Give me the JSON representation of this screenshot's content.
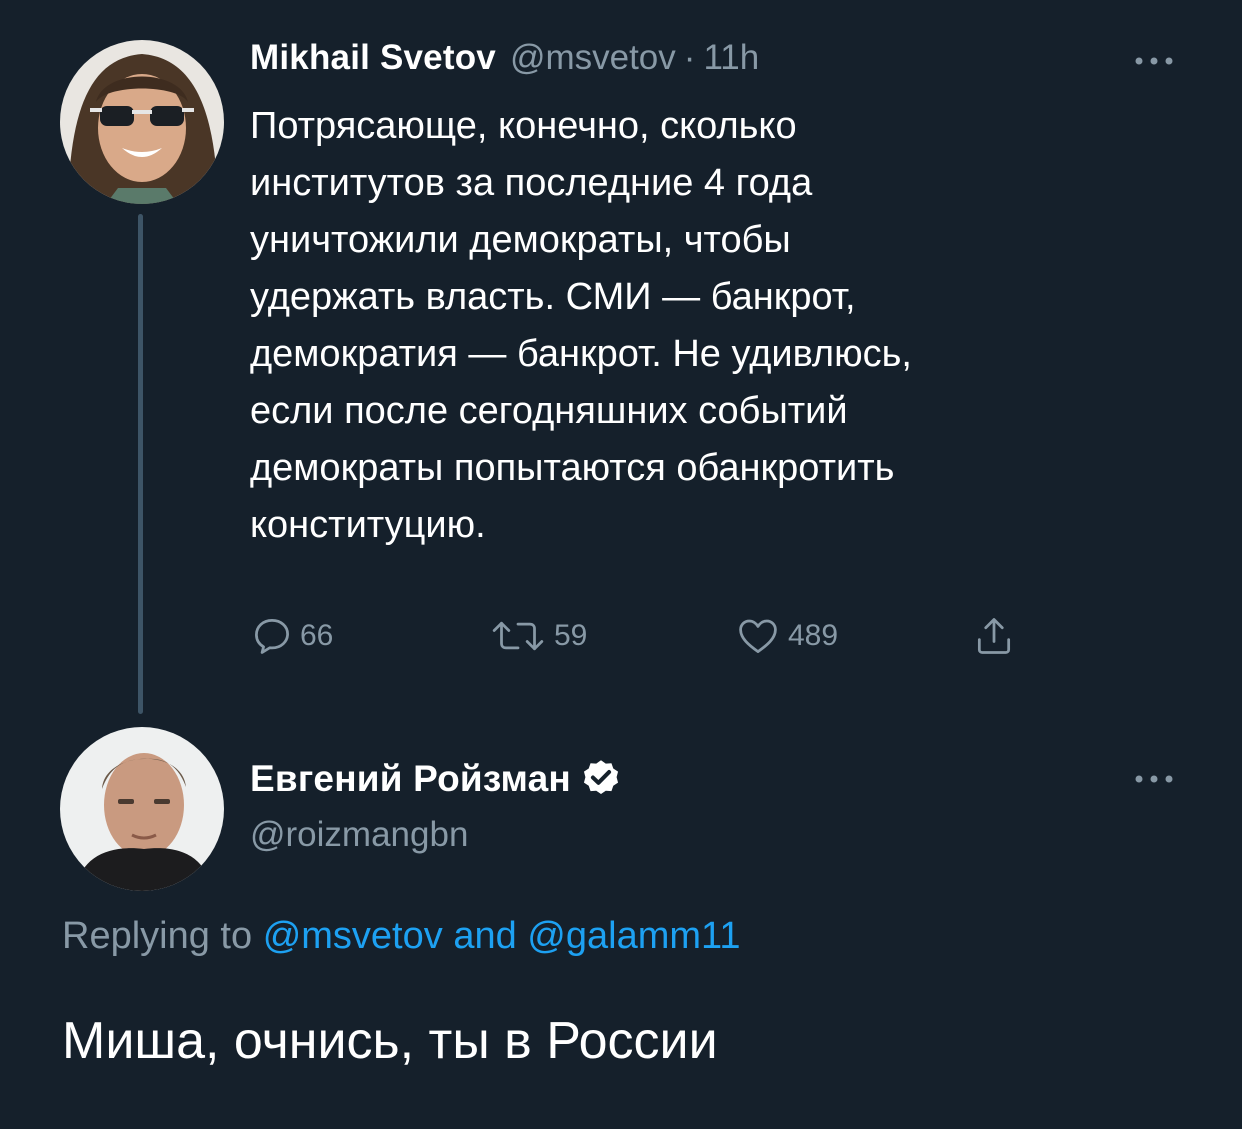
{
  "parent_tweet": {
    "display_name": "Mikhail Svetov",
    "handle": "@msvetov",
    "separator": "·",
    "time": "11h",
    "more_icon": "ellipsis-icon",
    "text": "Потрясающе, конечно, сколько\nинститутов за последние 4 года\nуничтожили демократы, чтобы\nудержать власть. СМИ — банкрот,\nдемократия — банкрот. Не удивлюсь,\nесли после сегодняшних событий\nдемократы попытаются обанкротить\nконституцию.",
    "actions": {
      "reply": {
        "icon": "reply-icon",
        "count": "66"
      },
      "retweet": {
        "icon": "retweet-icon",
        "count": "59"
      },
      "like": {
        "icon": "heart-icon",
        "count": "489"
      },
      "share": {
        "icon": "share-icon"
      }
    }
  },
  "reply_tweet": {
    "display_name": "Евгений Ройзман",
    "verified_icon": "verified-badge-icon",
    "handle": "@roizmangbn",
    "more_icon": "ellipsis-icon",
    "replying_prefix": "Replying to",
    "replying_user_1": "@msvetov",
    "replying_conjunction": "and",
    "replying_user_2": "@galamm11",
    "text": "Миша, очнись, ты в России"
  },
  "colors": {
    "background": "#15202b",
    "primary_text": "#ffffff",
    "secondary_text": "#8899a6",
    "link": "#1da1f2",
    "thread_line": "#3d5466"
  }
}
